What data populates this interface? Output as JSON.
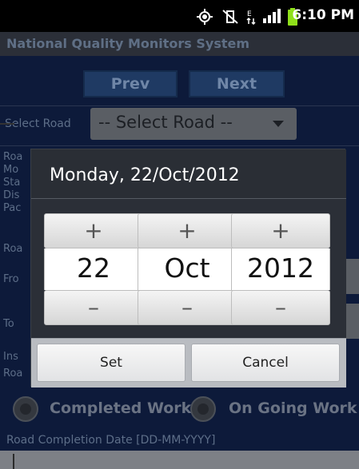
{
  "status_bar": {
    "time": "6:10 PM",
    "icons": [
      "gps-icon",
      "vibrate-muted-icon",
      "data-transfer-icon",
      "signal-icon",
      "battery-icon"
    ]
  },
  "app": {
    "title": "National Quality Monitors System"
  },
  "nav": {
    "prev_label": "Prev",
    "next_label": "Next"
  },
  "form": {
    "select_road_label": "Select Road",
    "select_road_value": "-- Select Road --",
    "partial_labels_left": [
      "Roa",
      "Mo",
      "Sta",
      "Dis",
      "Pac",
      "Roa",
      "Fro",
      "To",
      "Ins",
      "Roa"
    ],
    "radio_completed": "Completed Work",
    "radio_ongoing": "On Going Work",
    "completion_date_label": "Road Completion Date [DD-MM-YYYY]"
  },
  "date_dialog": {
    "title": "Monday, 22/Oct/2012",
    "day": {
      "value": "22",
      "plus": "+",
      "minus": "–"
    },
    "month": {
      "value": "Oct",
      "plus": "+",
      "minus": "–"
    },
    "year": {
      "value": "2012",
      "plus": "+",
      "minus": "–"
    },
    "set_label": "Set",
    "cancel_label": "Cancel"
  },
  "colors": {
    "status_bar_bg": "#000000",
    "title_bar_bg": "#2b2f38",
    "form_bg": "#0d1a3a",
    "dialog_bg": "#23272e",
    "battery": "#8fe01a"
  }
}
